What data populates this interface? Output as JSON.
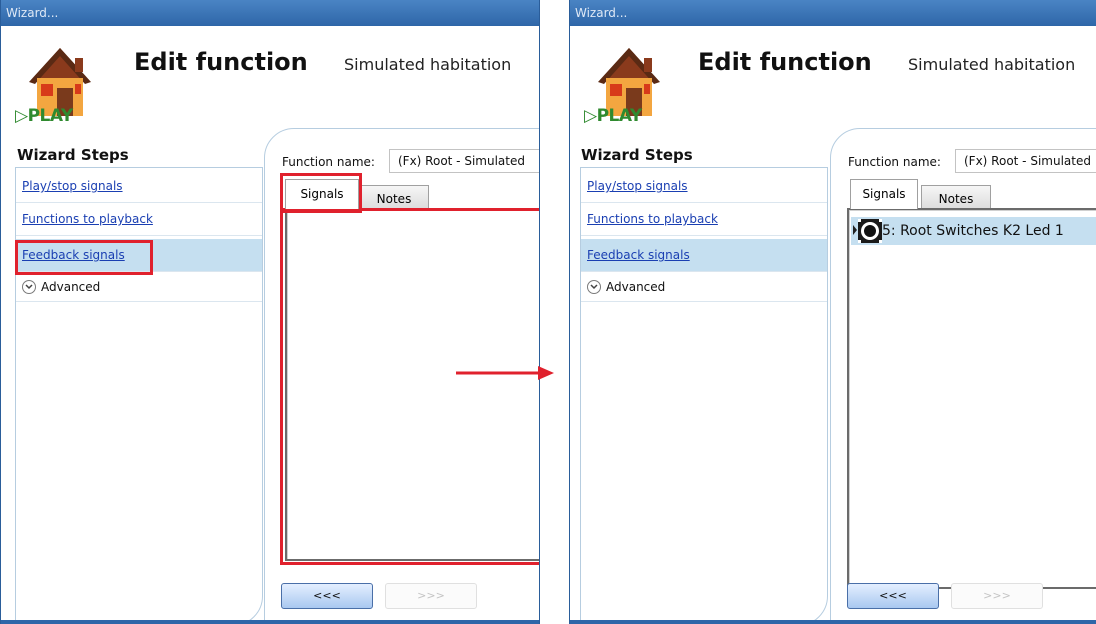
{
  "window": {
    "title": "Wizard..."
  },
  "header": {
    "title": "Edit function",
    "subtitle": "Simulated habitation",
    "play_label": "PLAY"
  },
  "wizard": {
    "title": "Wizard Steps",
    "steps": [
      {
        "label": "Play/stop signals"
      },
      {
        "label": "Functions to playback"
      },
      {
        "label": "Feedback signals"
      }
    ],
    "advanced_label": "Advanced"
  },
  "function": {
    "name_label": "Function name:",
    "left_value": "(Fx) Root - Simulated",
    "right_value": "(Fx) Root - Simulated"
  },
  "tabs": [
    {
      "label": "Signals"
    },
    {
      "label": "Notes"
    }
  ],
  "signals_list": [
    {
      "label": "5: Root Switches K2 Led 1"
    }
  ],
  "buttons": {
    "back": "<<<",
    "next": ">>>"
  },
  "colors": {
    "titlebar": "#2e66a8",
    "highlight": "#e0212d",
    "selection": "#c5dff0",
    "play": "#2f8a2f"
  }
}
